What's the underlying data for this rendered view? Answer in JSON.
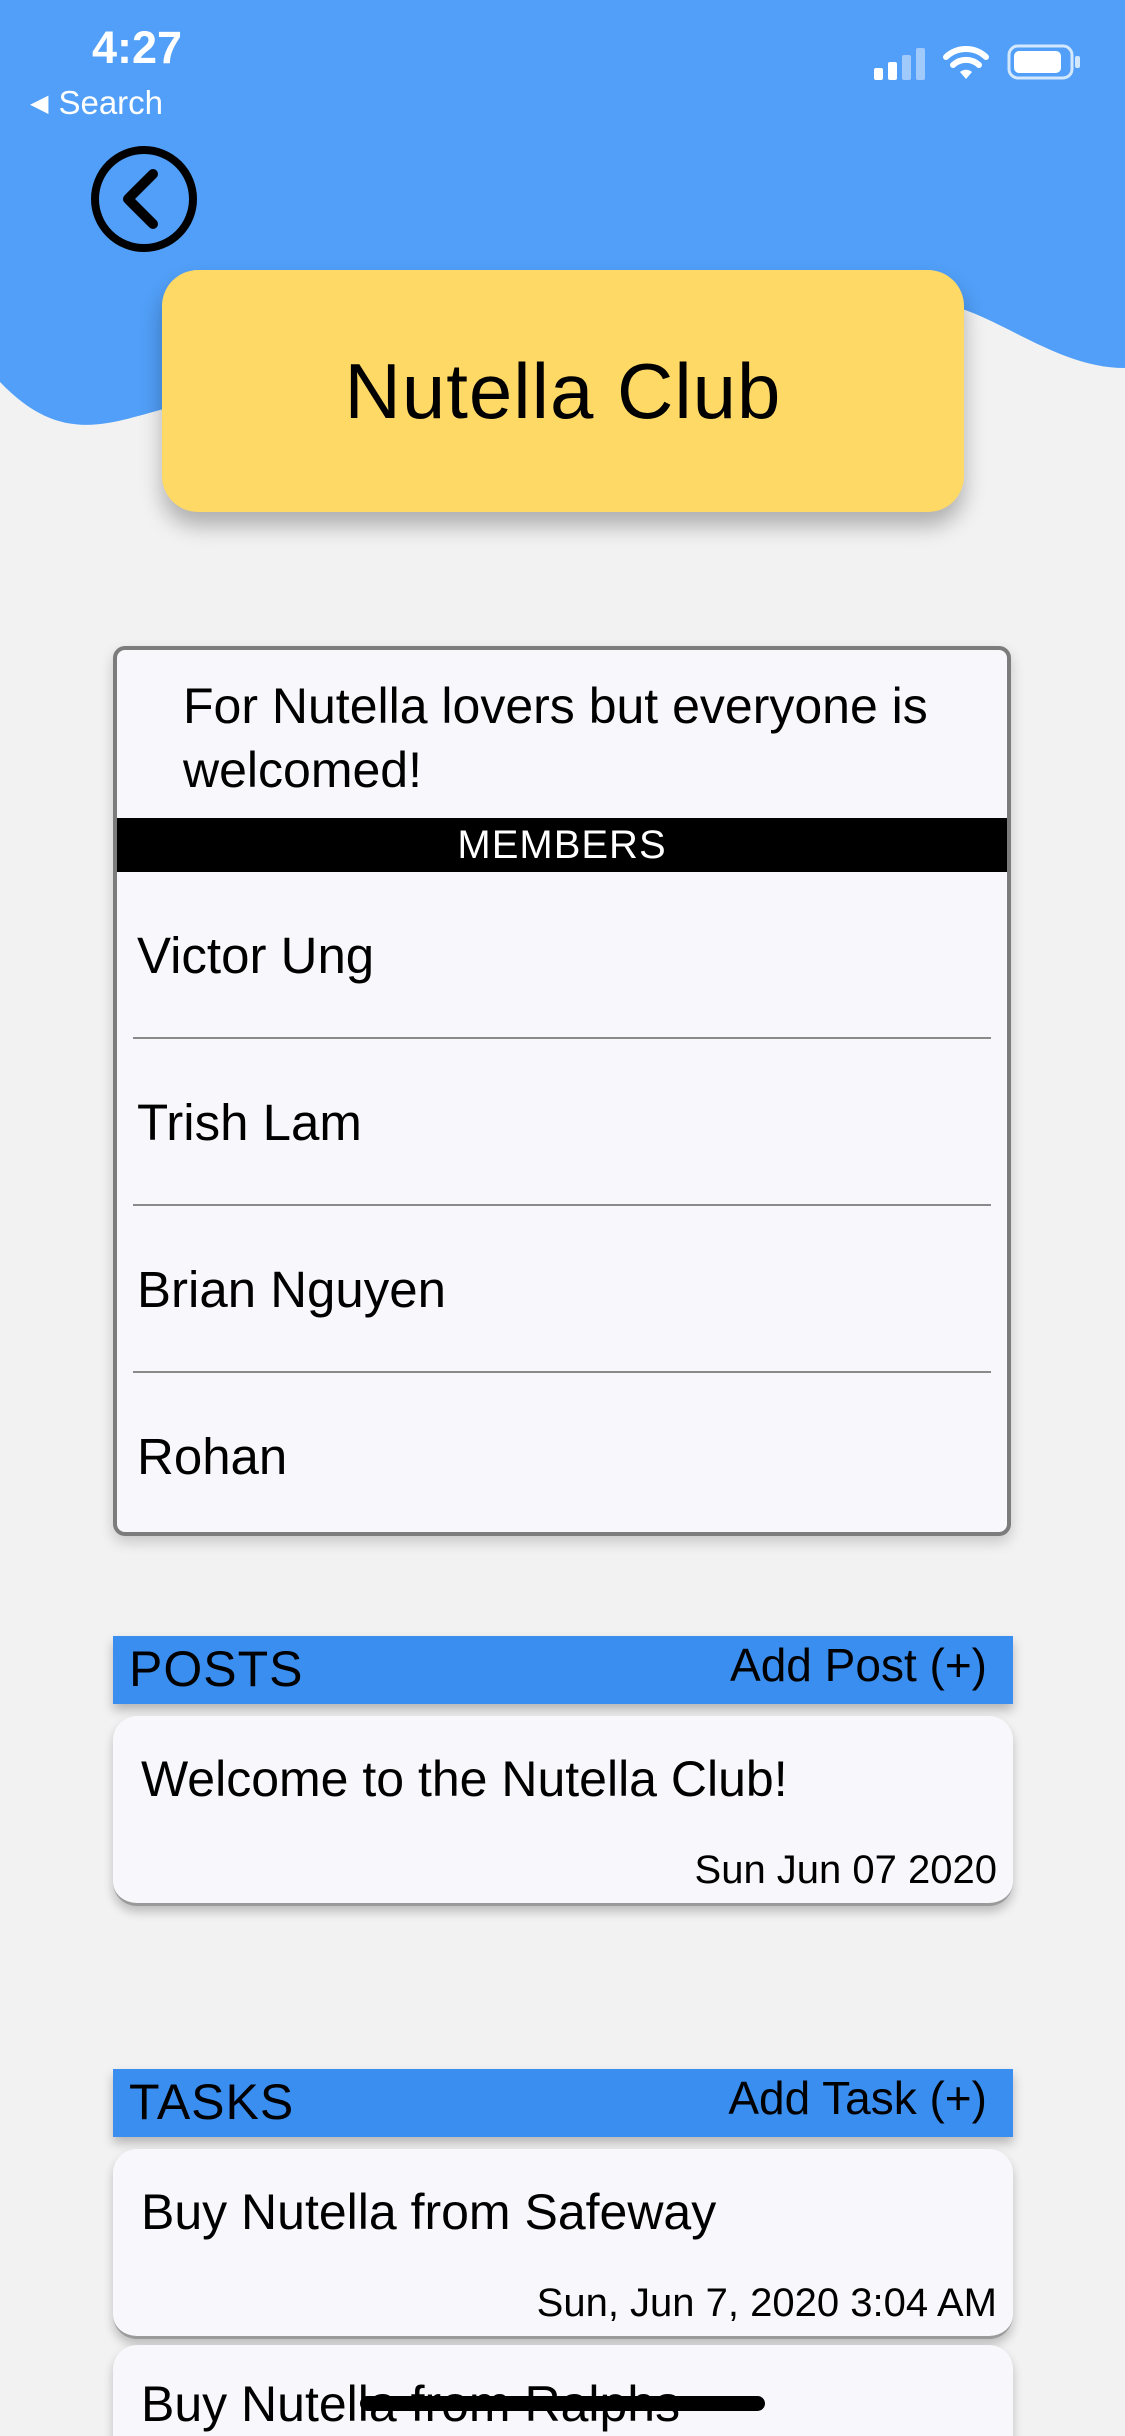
{
  "colors": {
    "header_blue": "#519ff8",
    "section_blue": "#3a8ef0",
    "title_card_yellow": "#ffd966",
    "background": "#f2f2f2",
    "card_background": "#f8f8fc"
  },
  "status_bar": {
    "time": "4:27",
    "back_label": "Search",
    "icons": [
      "signal-icon",
      "wifi-icon",
      "battery-icon"
    ]
  },
  "header": {
    "back_icon": "back-chevron-circle-icon",
    "title": "Nutella Club"
  },
  "club": {
    "description": "For Nutella lovers but everyone is welcomed!",
    "members_label": "MEMBERS",
    "members": [
      "Victor Ung",
      "Trish Lam",
      "Brian Nguyen",
      "Rohan"
    ]
  },
  "posts": {
    "title": "POSTS",
    "add_label": "Add Post (+)",
    "items": [
      {
        "title": "Welcome to the Nutella Club!",
        "date": "Sun Jun 07 2020"
      }
    ]
  },
  "tasks": {
    "title": "TASKS",
    "add_label": "Add Task (+)",
    "items": [
      {
        "title": "Buy Nutella from Safeway",
        "date": "Sun, Jun 7, 2020 3:04 AM"
      },
      {
        "title": "Buy Nutella from Ralphs"
      }
    ]
  }
}
